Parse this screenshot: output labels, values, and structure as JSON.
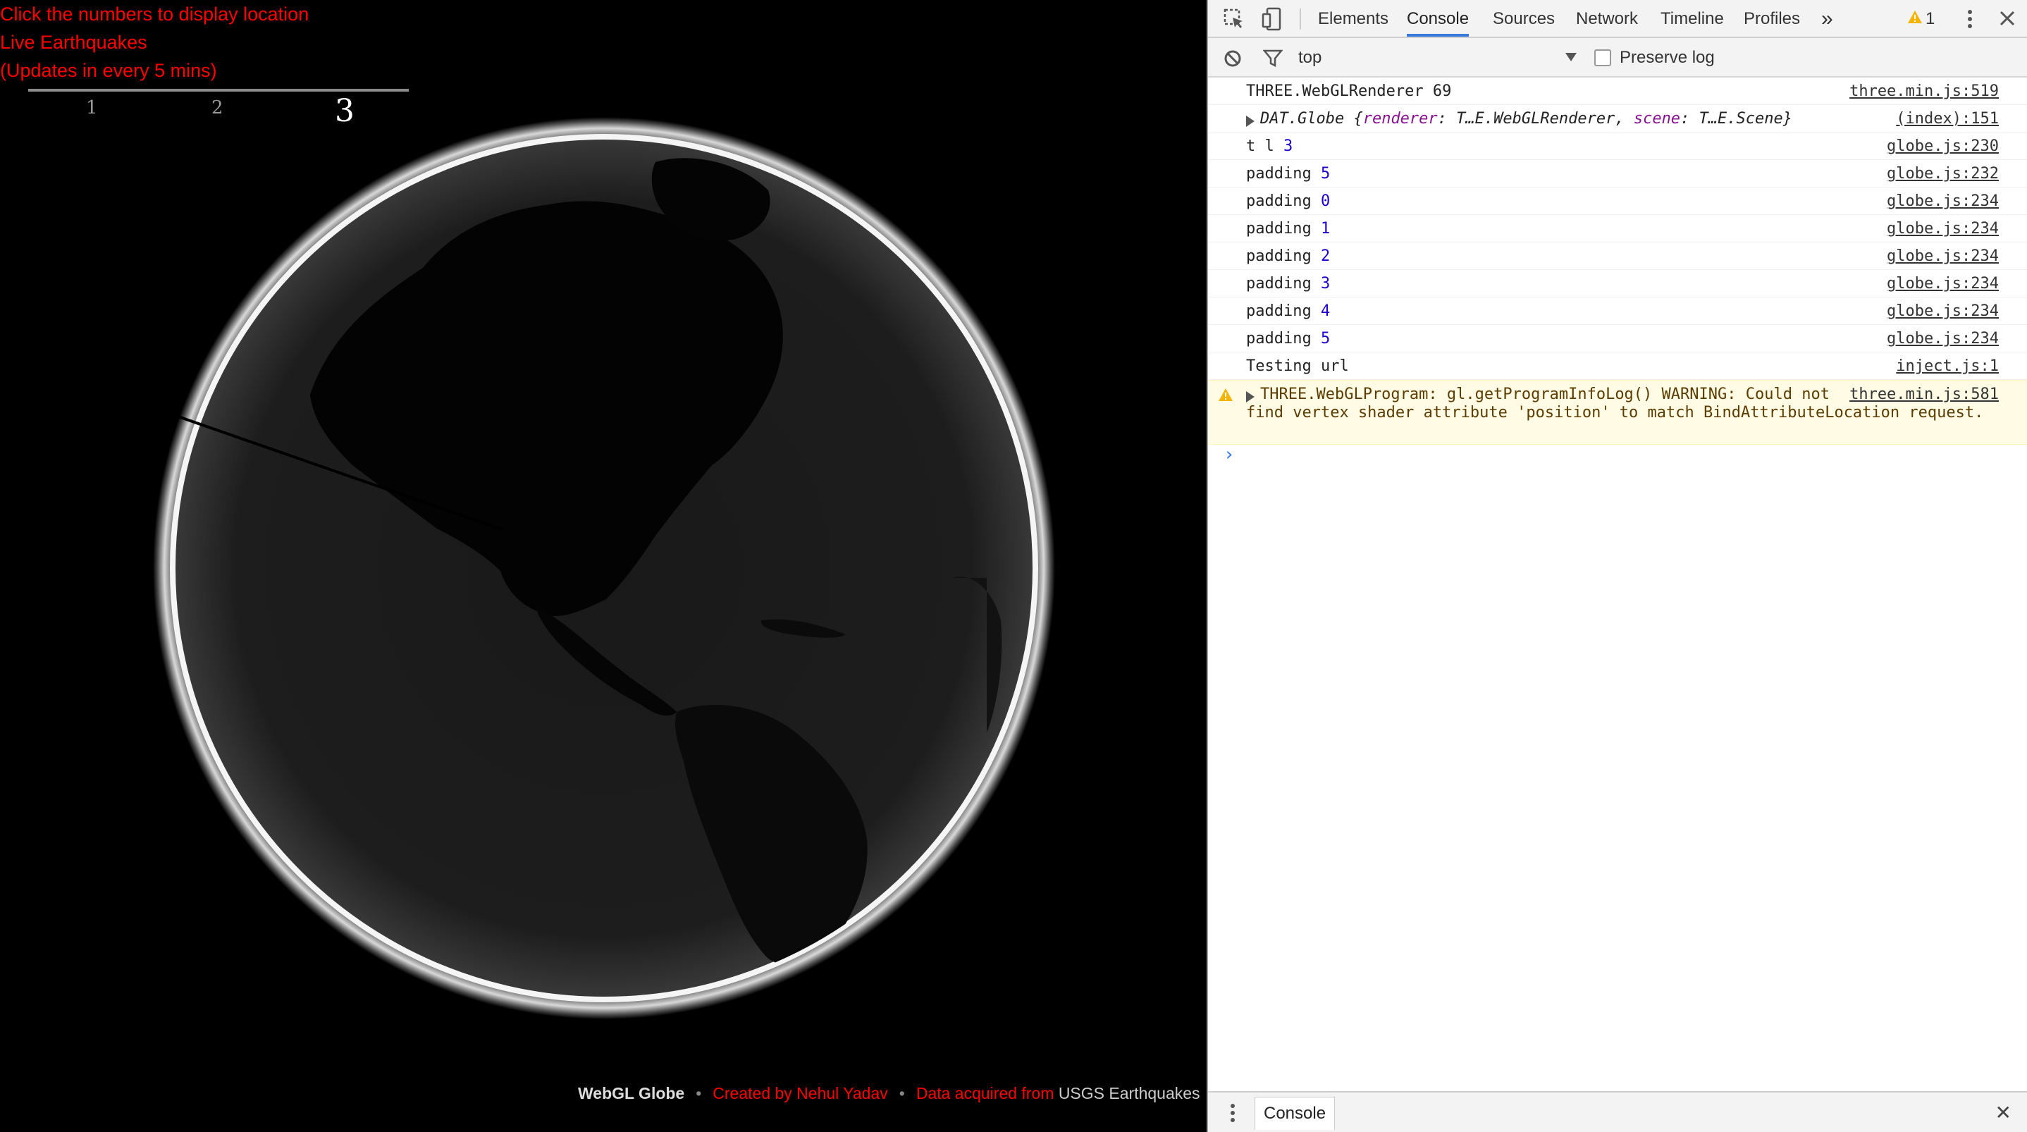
{
  "page": {
    "info_lines": [
      "Click the numbers to display location",
      "Live Earthquakes",
      "(Updates in every 5 mins)"
    ],
    "years": [
      {
        "label": "1",
        "active": false
      },
      {
        "label": "2",
        "active": false
      },
      {
        "label": "3",
        "active": true
      }
    ],
    "footer": {
      "title": "WebGL Globe",
      "separator": "•",
      "created_by": "Created by Nehul Yadav",
      "data_prefix": "Data acquired from",
      "data_source": "USGS Earthquakes"
    }
  },
  "devtools": {
    "tabs": [
      "Elements",
      "Console",
      "Sources",
      "Network",
      "Timeline",
      "Profiles"
    ],
    "active_tab": "Console",
    "more_label": "»",
    "warning_count": "1",
    "context": "top",
    "preserve_log_label": "Preserve log",
    "console_rows": [
      {
        "msg": "THREE.WebGLRenderer 69",
        "src": "three.min.js:519"
      },
      {
        "msg_prefix": "DAT.Globe {",
        "k1": "renderer",
        "v1": ": T…E.WebGLRenderer, ",
        "k2": "scene",
        "v2": ": T…E.Scene}",
        "src": "(index):151"
      },
      {
        "msg": "t l",
        "n": "3",
        "src": "globe.js:230"
      },
      {
        "msg": "padding",
        "n": "5",
        "src": "globe.js:232"
      },
      {
        "msg": "padding",
        "n": "0",
        "src": "globe.js:234"
      },
      {
        "msg": "padding",
        "n": "1",
        "src": "globe.js:234"
      },
      {
        "msg": "padding",
        "n": "2",
        "src": "globe.js:234"
      },
      {
        "msg": "padding",
        "n": "3",
        "src": "globe.js:234"
      },
      {
        "msg": "padding",
        "n": "4",
        "src": "globe.js:234"
      },
      {
        "msg": "padding",
        "n": "5",
        "src": "globe.js:234"
      },
      {
        "msg": "Testing url",
        "src": "inject.js:1"
      }
    ],
    "warning": {
      "line1": "THREE.WebGLProgram: gl.getProgramInfoLog() WARNING: Could not",
      "line2": "find vertex shader attribute 'position' to match BindAttributeLocation request.",
      "src": "three.min.js:581"
    },
    "prompt": "›",
    "drawer_tab": "Console",
    "close": "✕"
  },
  "colors": {
    "accent_red": "#ff0000",
    "devtools_blue": "#3879d9",
    "number_blue": "#1c00cf"
  }
}
